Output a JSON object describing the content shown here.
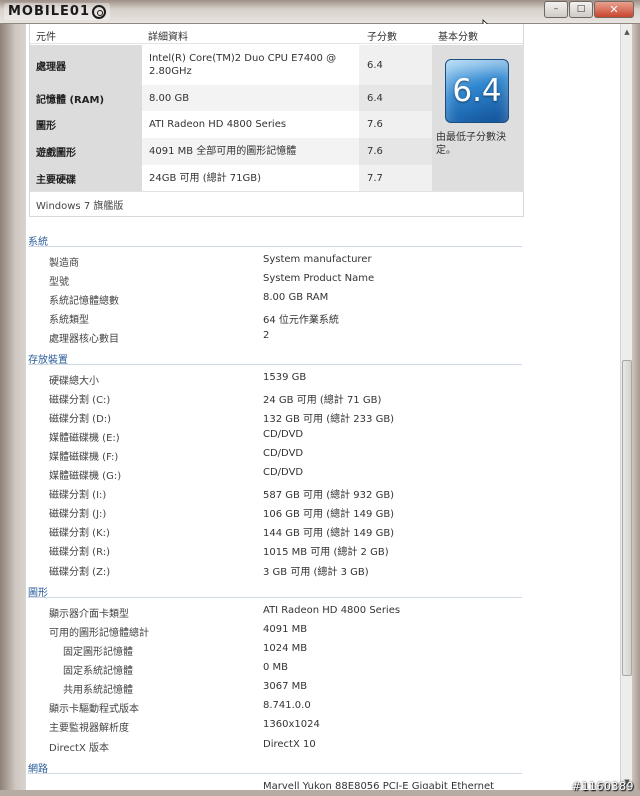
{
  "brand": {
    "logo_text": "MOBILE01"
  },
  "window_controls": {
    "minimize": "–",
    "maximize": "□",
    "close": "✕"
  },
  "rating_table": {
    "headers": {
      "component": "元件",
      "details": "詳細資料",
      "subscore": "子分數",
      "base_score": "基本分數"
    },
    "rows": [
      {
        "component": "處理器",
        "details": "Intel(R) Core(TM)2 Duo CPU E7400 @ 2.80GHz",
        "subscore": "6.4"
      },
      {
        "component": "記憶體 (RAM)",
        "details": "8.00 GB",
        "subscore": "6.4"
      },
      {
        "component": "圖形",
        "details": "ATI Radeon HD 4800 Series",
        "subscore": "7.6"
      },
      {
        "component": "遊戲圖形",
        "details": "4091 MB 全部可用的圖形記憶體",
        "subscore": "7.6"
      },
      {
        "component": "主要硬碟",
        "details": "24GB 可用 (總計 71GB)",
        "subscore": "7.7"
      }
    ],
    "base_score_value": "6.4",
    "base_score_note": "由最低子分數決定。",
    "edition": "Windows 7 旗艦版"
  },
  "system": {
    "heading": "系統",
    "items": [
      {
        "key": "製造商",
        "value": "System manufacturer"
      },
      {
        "key": "型號",
        "value": "System Product Name"
      },
      {
        "key": "系統記憶體總數",
        "value": "8.00 GB RAM"
      },
      {
        "key": "系統類型",
        "value": "64 位元作業系統"
      },
      {
        "key": "處理器核心數目",
        "value": "2"
      }
    ]
  },
  "storage": {
    "heading": "存放裝置",
    "items": [
      {
        "key": "硬碟總大小",
        "value": "1539 GB"
      },
      {
        "key": "磁碟分割 (C:)",
        "value": "24 GB 可用 (總計 71 GB)"
      },
      {
        "key": "磁碟分割 (D:)",
        "value": "132 GB 可用 (總計 233 GB)"
      },
      {
        "key": "媒體磁碟機 (E:)",
        "value": "CD/DVD"
      },
      {
        "key": "媒體磁碟機 (F:)",
        "value": "CD/DVD"
      },
      {
        "key": "媒體磁碟機 (G:)",
        "value": "CD/DVD"
      },
      {
        "key": "磁碟分割 (I:)",
        "value": "587 GB 可用 (總計 932 GB)"
      },
      {
        "key": "磁碟分割 (J:)",
        "value": "106 GB 可用 (總計 149 GB)"
      },
      {
        "key": "磁碟分割 (K:)",
        "value": "144 GB 可用 (總計 149 GB)"
      },
      {
        "key": "磁碟分割 (R:)",
        "value": "1015 MB 可用 (總計 2 GB)"
      },
      {
        "key": "磁碟分割 (Z:)",
        "value": "3 GB 可用 (總計 3 GB)"
      }
    ]
  },
  "graphics": {
    "heading": "圖形",
    "items": [
      {
        "key": "顯示器介面卡類型",
        "value": "ATI Radeon HD 4800 Series"
      },
      {
        "key": "可用的圖形記憶體總計",
        "value": "4091 MB"
      },
      {
        "key": "固定圖形記憶體",
        "value": "1024 MB"
      },
      {
        "key": "固定系統記憶體",
        "value": "0 MB"
      },
      {
        "key": "共用系統記憶體",
        "value": "3067 MB"
      },
      {
        "key": "顯示卡驅動程式版本",
        "value": "8.741.0.0"
      },
      {
        "key": "主要監視器解析度",
        "value": "1360x1024"
      },
      {
        "key": "DirectX 版本",
        "value": "DirectX 10"
      }
    ]
  },
  "network": {
    "heading": "網路",
    "first_value": "Marvell Yukon 88E8056 PCI-E Gigabit Ethernet"
  },
  "watermark": "#1160389"
}
